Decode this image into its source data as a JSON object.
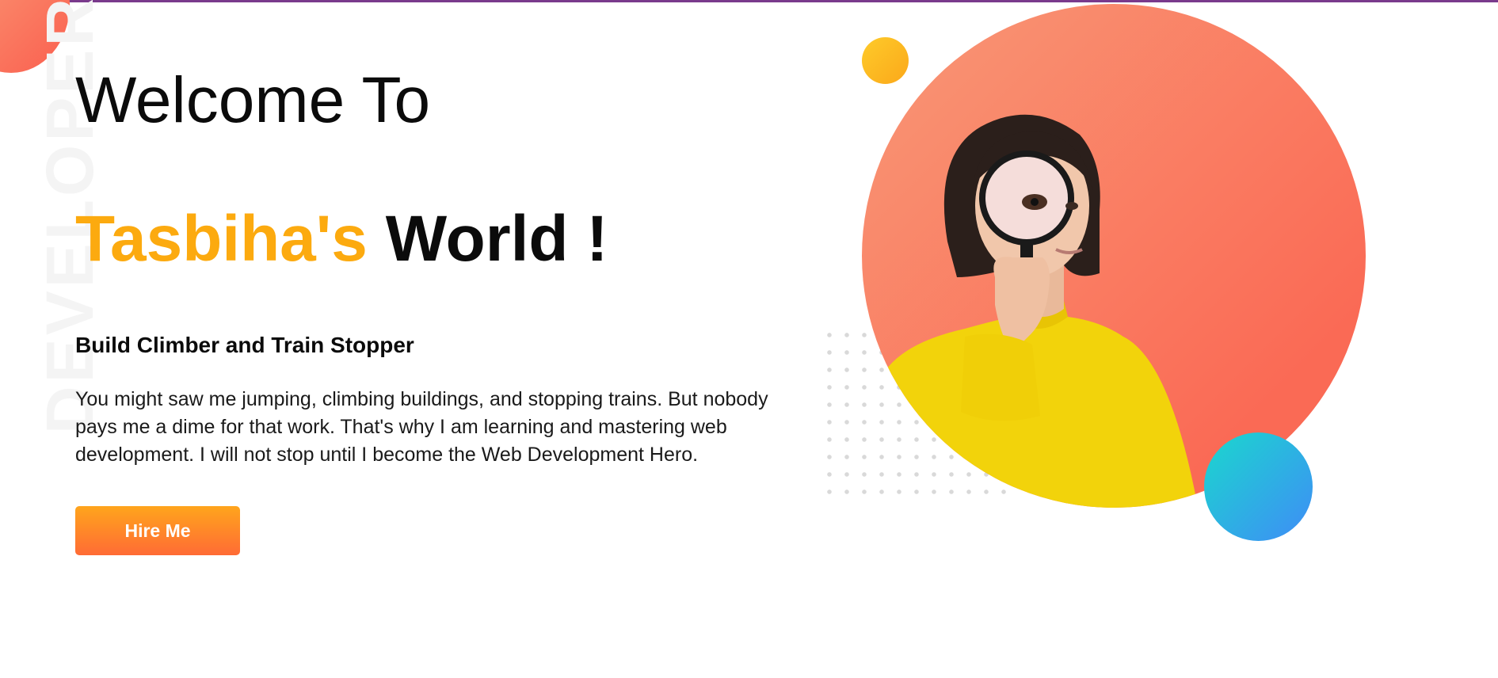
{
  "hero": {
    "background_word": "DEVELOPER",
    "welcome": "Welcome To",
    "name": "Tasbiha's",
    "world": "World !",
    "subtitle": "Build Climber and Train Stopper",
    "bio": "You might saw me jumping, climbing buildings, and stopping trains. But nobody pays me a dime for that work. That's why I am learning and mastering web development. I will not stop until I become the Web Development Hero.",
    "hire_button": "Hire Me"
  },
  "colors": {
    "accent": "#fcaa0f",
    "button_start": "#ffa51c",
    "button_end": "#ff6b35",
    "circle_start": "#f99272",
    "circle_end": "#fa6a55",
    "teal_start": "#1ad8cd",
    "teal_end": "#3f8cf7"
  },
  "icons": {
    "portrait": "woman-with-magnifying-glass"
  }
}
